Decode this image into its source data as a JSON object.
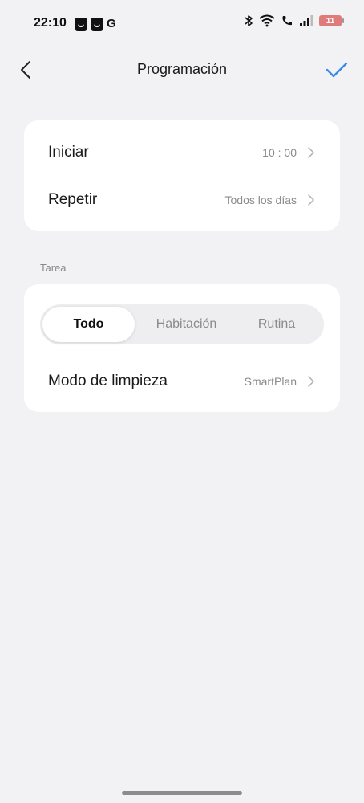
{
  "status_bar": {
    "time": "22:10",
    "notification_icons": [
      "notification-app-icon",
      "notification-app-icon",
      "g-icon"
    ],
    "g_label": "G",
    "system_icons": [
      "bluetooth-icon",
      "wifi-icon",
      "call-icon",
      "signal-icon",
      "battery-icon"
    ],
    "battery_level": "11",
    "battery_color": "#e07b7b"
  },
  "header": {
    "title": "Programación",
    "back_icon": "chevron-left-icon",
    "confirm_icon": "checkmark-icon",
    "accent_color": "#3b8bea"
  },
  "schedule": {
    "start_label": "Iniciar",
    "start_value": "10 : 00",
    "repeat_label": "Repetir",
    "repeat_value": "Todos los días"
  },
  "task": {
    "section_label": "Tarea",
    "tabs": [
      {
        "label": "Todo",
        "selected": true
      },
      {
        "label": "Habitación",
        "selected": false
      },
      {
        "label": "Rutina",
        "selected": false
      }
    ],
    "mode_label": "Modo de limpieza",
    "mode_value": "SmartPlan"
  }
}
